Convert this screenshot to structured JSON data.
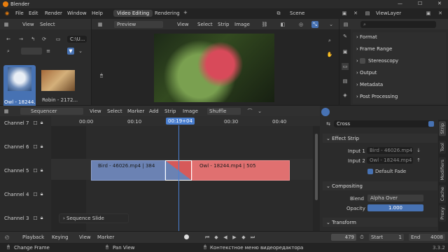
{
  "titlebar": {
    "title": "Blender",
    "minimize": "—",
    "maximize": "☐",
    "close": "✕"
  },
  "menubar": {
    "items": [
      "File",
      "Edit",
      "Render",
      "Window",
      "Help"
    ],
    "workspace_tabs": [
      "Video Editing",
      "Rendering"
    ],
    "add_tab": "+",
    "scene": "Scene",
    "viewlayer": "ViewLayer"
  },
  "filebrowser": {
    "menu": [
      "View",
      "Select"
    ],
    "path": "C:\\U...",
    "files": [
      {
        "name": "Owl - 18244...",
        "selected": true
      },
      {
        "name": "Robin - 2172...",
        "selected": false
      }
    ]
  },
  "preview": {
    "mode": "Preview",
    "menu": [
      "View",
      "Select",
      "Strip",
      "Image"
    ]
  },
  "properties_top": {
    "items": [
      "Format",
      "Frame Range",
      "Stereoscopy",
      "Output",
      "Metadata",
      "Post Processing"
    ]
  },
  "sequencer": {
    "mode": "Sequencer",
    "menu": [
      "View",
      "Select",
      "Marker",
      "Add",
      "Strip",
      "Image"
    ],
    "shuffle": "Shuffle",
    "time_ticks": [
      "00:00",
      "00:10",
      "00:20",
      "00:30",
      "00:40"
    ],
    "current_time": "00:19+04",
    "channels": [
      "Channel 7",
      "Channel 6",
      "Channel 5",
      "Channel 4",
      "Channel 3"
    ],
    "strips": {
      "bird": "Bird - 46026.mp4 | 384",
      "owl": "Owl - 18244.mp4 | 505"
    },
    "redo_panel": "Sequence Slide"
  },
  "strip_props": {
    "name": "Cross",
    "effect_strip": "Effect Strip",
    "input1_label": "Input 1",
    "input1": "Bird - 46026.mp4",
    "input2_label": "Input 2",
    "input2": "Owl - 18244.mp4",
    "default_fade": "Default Fade",
    "compositing": "Compositing",
    "blend_label": "Blend",
    "blend": "Alpha Over",
    "opacity_label": "Opacity",
    "opacity": "1.000",
    "transform": "Transform",
    "side_tabs": [
      "Strip",
      "Tool",
      "Modifiers",
      "Cache",
      "Proxy"
    ]
  },
  "timeline": {
    "menu": [
      "Playback",
      "Keying",
      "View",
      "Marker"
    ],
    "frame": "479",
    "start_label": "Start",
    "start": "1",
    "end_label": "End",
    "end": "4008"
  },
  "status": {
    "change_frame": "Change Frame",
    "pan_view": "Pan View",
    "context": "Контекстное меню видеоредактора",
    "version": "3.3.2"
  },
  "colors": {
    "accent": "#4772b3",
    "strip_blue": "#6b82b3",
    "strip_red": "#e07070",
    "playhead": "#4a7fd0"
  }
}
